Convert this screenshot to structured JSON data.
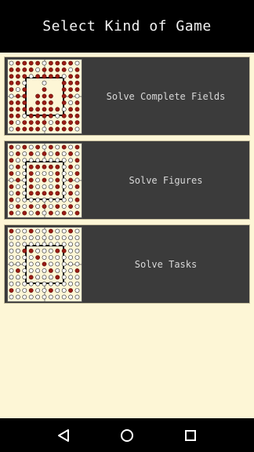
{
  "header": {
    "title": "Select Kind of Game"
  },
  "games": [
    {
      "label": "Solve Complete Fields",
      "thumbnail": "complete-fields-board"
    },
    {
      "label": "Solve Figures",
      "thumbnail": "figures-board"
    },
    {
      "label": "Solve Tasks",
      "thumbnail": "tasks-board"
    }
  ],
  "navbar": {
    "back": "back-triangle-icon",
    "home": "home-circle-icon",
    "recents": "recents-square-icon"
  },
  "colors": {
    "background": "#fdf6d6",
    "card": "#3b3b3b",
    "peg": "#9b1c14",
    "hole": "#ffffff"
  }
}
